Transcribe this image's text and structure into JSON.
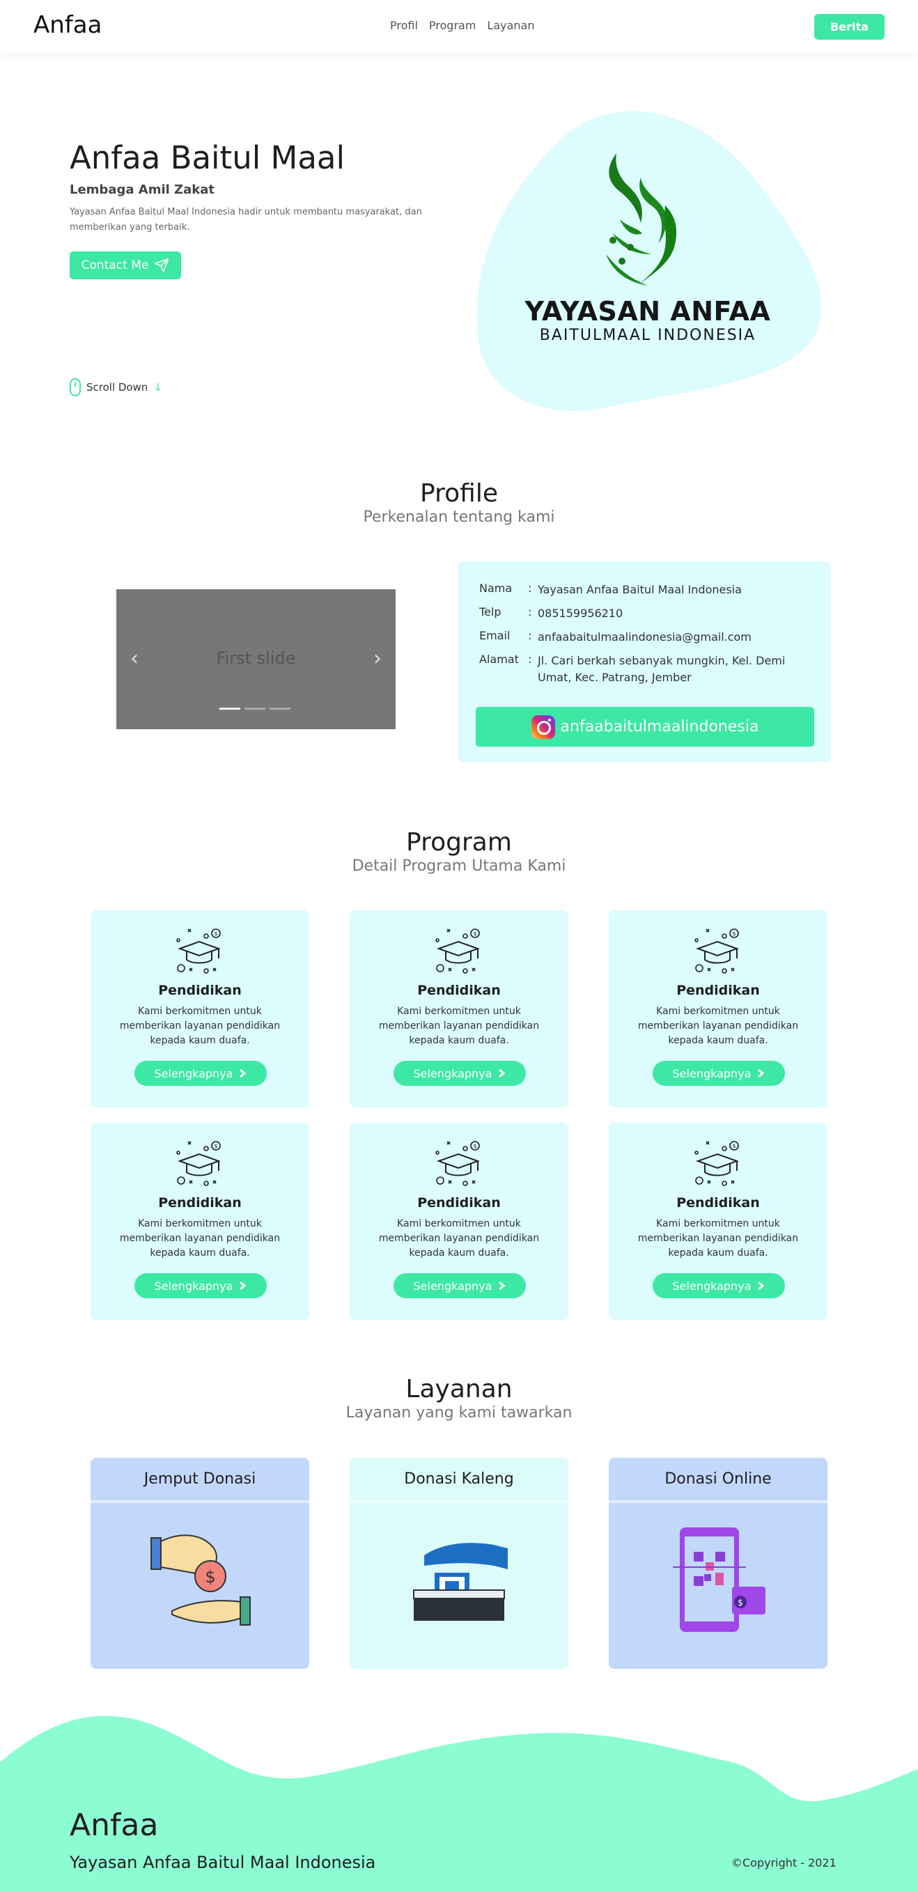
{
  "nav": {
    "brand": "Anfaa",
    "links": [
      "Profil",
      "Program",
      "Layanan"
    ],
    "cta": "Berita"
  },
  "hero": {
    "title": "Anfaa Baitul Maal",
    "subtitle": "Lembaga Amil Zakat",
    "description": "Yayasan Anfaa Baitul Maal Indonesia hadir untuk membantu masyarakat, dan memberikan yang terbaik.",
    "contact_button": "Contact Me",
    "scroll_label": "Scroll Down",
    "scroll_arrow": "↓",
    "logo_line1": "YAYASAN ANFAA",
    "logo_line2": "BAITULMAAL INDONESIA"
  },
  "profile": {
    "title": "Profile",
    "subtitle": "Perkenalan tentang kami",
    "carousel_caption": "First slide",
    "rows": [
      {
        "label": "Nama",
        "value": "Yayasan Anfaa Baitul Maal Indonesia"
      },
      {
        "label": "Telp",
        "value": "085159956210"
      },
      {
        "label": "Email",
        "value": "anfaabaitulmaalindonesia@gmail.com"
      },
      {
        "label": "Alamat",
        "value": "Jl. Cari berkah sebanyak mungkin, Kel. Demi Umat, Kec. Patrang, Jember"
      }
    ],
    "instagram": "anfaabaitulmaalindonesia"
  },
  "program": {
    "title": "Program",
    "subtitle": "Detail Program Utama Kami",
    "cards": [
      {
        "title": "Pendidikan",
        "desc": "Kami berkomitmen untuk memberikan layanan pendidikan kepada kaum duafa.",
        "button": "Selengkapnya"
      },
      {
        "title": "Pendidikan",
        "desc": "Kami berkomitmen untuk memberikan layanan pendidikan kepada kaum duafa.",
        "button": "Selengkapnya"
      },
      {
        "title": "Pendidikan",
        "desc": "Kami berkomitmen untuk memberikan layanan pendidikan kepada kaum duafa.",
        "button": "Selengkapnya"
      },
      {
        "title": "Pendidikan",
        "desc": "Kami berkomitmen untuk memberikan layanan pendidikan kepada kaum duafa.",
        "button": "Selengkapnya"
      },
      {
        "title": "Pendidikan",
        "desc": "Kami berkomitmen untuk memberikan layanan pendidikan kepada kaum duafa.",
        "button": "Selengkapnya"
      },
      {
        "title": "Pendidikan",
        "desc": "Kami berkomitmen untuk memberikan layanan pendidikan kepada kaum duafa.",
        "button": "Selengkapnya"
      }
    ]
  },
  "layanan": {
    "title": "Layanan",
    "subtitle": "Layanan yang kami tawarkan",
    "cards": [
      {
        "title": "Jemput Donasi"
      },
      {
        "title": "Donasi Kaleng"
      },
      {
        "title": "Donasi Online"
      }
    ]
  },
  "footer": {
    "brand": "Anfaa",
    "subtitle": "Yayasan Anfaa Baitul Maal Indonesia",
    "copyright": "©Copyright - 2021"
  },
  "colors": {
    "accent": "#3de8a5",
    "card_bg": "#dcfcfd",
    "card_blue": "#c1d8fb",
    "footer_bg": "#8cfcd3",
    "logo_green": "#1a8a1a"
  }
}
